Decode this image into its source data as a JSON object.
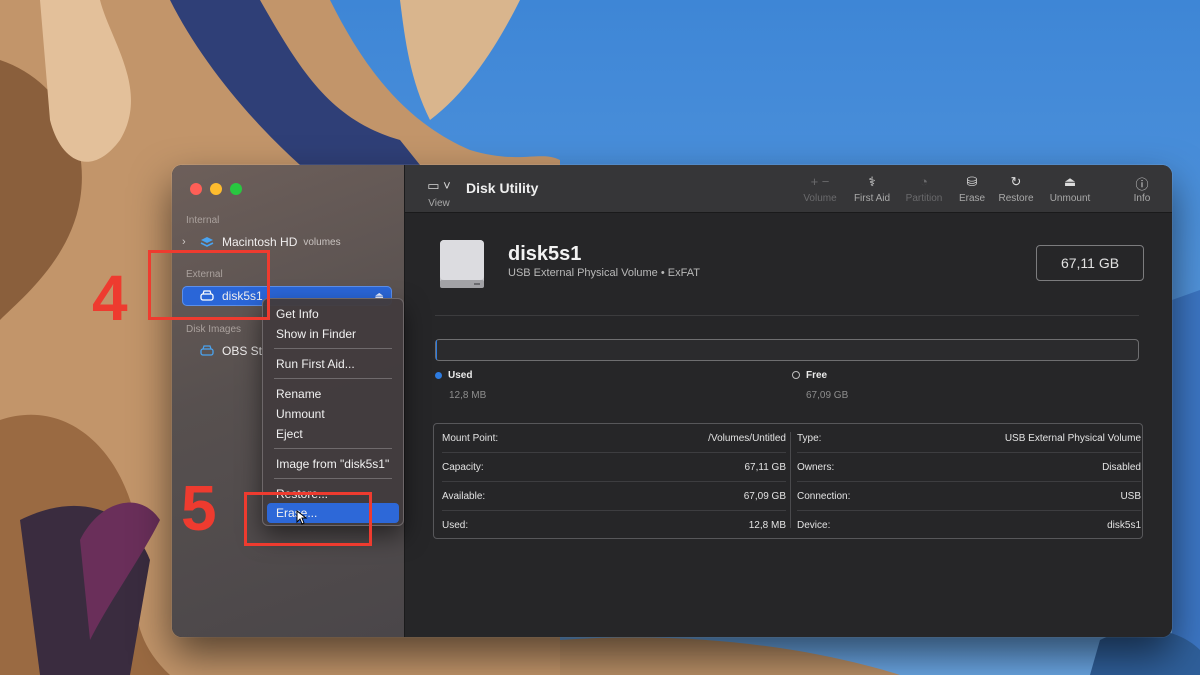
{
  "window": {
    "title": "Disk Utility"
  },
  "sidebar": {
    "sections": {
      "internal": "Internal",
      "external": "External",
      "disk_images": "Disk Images"
    },
    "items": [
      {
        "label": "Macintosh HD",
        "sublabel": "volumes"
      },
      {
        "label": "disk5s1",
        "selected": true
      },
      {
        "label": "OBS St"
      }
    ]
  },
  "toolbar": {
    "view": "View",
    "buttons": [
      {
        "label": "Volume",
        "icon": "plus-minus-icon",
        "enabled": false
      },
      {
        "label": "First Aid",
        "icon": "stethoscope-icon",
        "enabled": true
      },
      {
        "label": "Partition",
        "icon": "pie-chart-icon",
        "enabled": false
      },
      {
        "label": "Erase",
        "icon": "erase-drive-icon",
        "enabled": true
      },
      {
        "label": "Restore",
        "icon": "restore-icon",
        "enabled": true
      },
      {
        "label": "Unmount",
        "icon": "eject-icon",
        "enabled": true
      },
      {
        "label": "Info",
        "icon": "info-icon",
        "enabled": true
      }
    ]
  },
  "volume": {
    "name": "disk5s1",
    "description": "USB External Physical Volume • ExFAT",
    "capacity": "67,11 GB",
    "used_fraction": 0.0002,
    "used_label": "Used",
    "used_value": "12,8 MB",
    "free_label": "Free",
    "free_value": "67,09 GB"
  },
  "info": {
    "left": [
      {
        "key": "Mount Point:",
        "value": "/Volumes/Untitled"
      },
      {
        "key": "Capacity:",
        "value": "67,11 GB"
      },
      {
        "key": "Available:",
        "value": "67,09 GB"
      },
      {
        "key": "Used:",
        "value": "12,8 MB"
      }
    ],
    "right": [
      {
        "key": "Type:",
        "value": "USB External Physical Volume"
      },
      {
        "key": "Owners:",
        "value": "Disabled"
      },
      {
        "key": "Connection:",
        "value": "USB"
      },
      {
        "key": "Device:",
        "value": "disk5s1"
      }
    ]
  },
  "context_menu": {
    "items": [
      "Get Info",
      "Show in Finder",
      "Run First Aid...",
      "Rename",
      "Unmount",
      "Eject",
      "Image from \"disk5s1\"",
      "Restore...",
      "Erase..."
    ]
  },
  "annotations": {
    "step4": "4",
    "step5": "5"
  },
  "colors": {
    "accent": "#2d68d8",
    "annotation": "#ee3b2f"
  }
}
